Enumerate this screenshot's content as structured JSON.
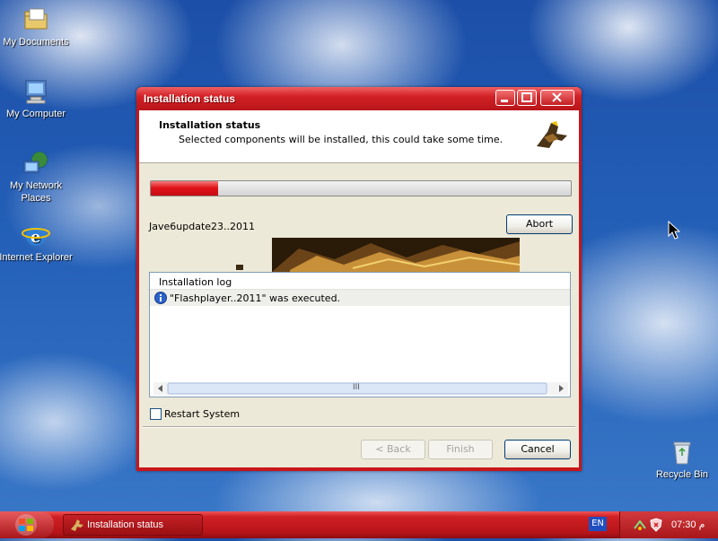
{
  "desktop": {
    "icons": [
      {
        "label": "My Documents"
      },
      {
        "label": "My Computer"
      },
      {
        "label": "My Network Places"
      },
      {
        "label": "Internet Explorer"
      },
      {
        "label": "Recycle Bin"
      }
    ]
  },
  "window": {
    "title": "Installation status",
    "header": {
      "title": "Installation status",
      "subtitle": "Selected components will be installed, this could take some time."
    },
    "progress": {
      "percent": 16
    },
    "current_item": "Jave6update23..2011",
    "abort_label": "Abort",
    "log": {
      "header": "Installation log",
      "entries": [
        "\"Flashplayer..2011\" was executed."
      ],
      "scroll_grip": "III"
    },
    "restart_label": "Restart System",
    "buttons": {
      "back": "< Back",
      "finish": "Finish",
      "cancel": "Cancel"
    }
  },
  "taskbar": {
    "task_label": "Installation status",
    "language": "EN",
    "clock": "م 07:30"
  },
  "colors": {
    "accent": "#d22126",
    "taskbar": "#b51419",
    "progress": "#e0141a"
  }
}
